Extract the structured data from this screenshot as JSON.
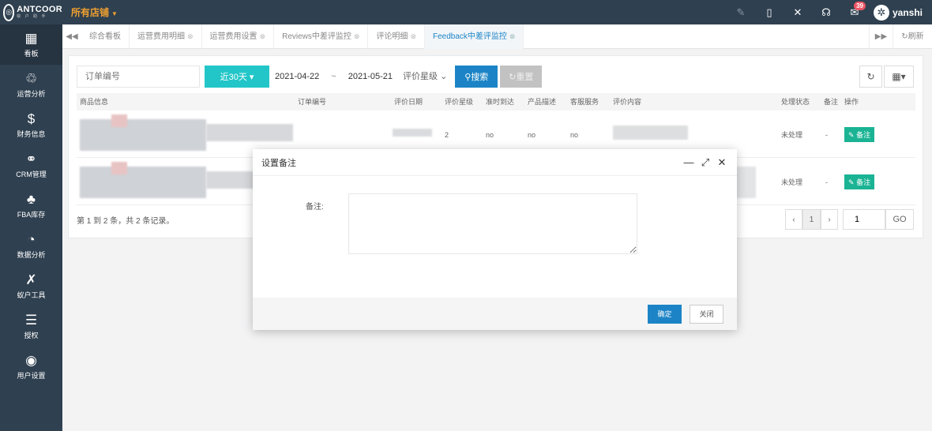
{
  "header": {
    "logo_text": "ANTCOOR",
    "logo_sub": "蚁 户 助 手",
    "shop_label": "所有店铺",
    "notifications_count": "39",
    "username": "yanshi"
  },
  "sidebar": {
    "items": [
      {
        "label": "看板",
        "icon": "dashboard-icon"
      },
      {
        "label": "运营分析",
        "icon": "analysis-icon"
      },
      {
        "label": "财务信息",
        "icon": "finance-icon"
      },
      {
        "label": "CRM管理",
        "icon": "crm-icon"
      },
      {
        "label": "FBA库存",
        "icon": "inventory-icon"
      },
      {
        "label": "数据分析",
        "icon": "pie-chart-icon"
      },
      {
        "label": "蚁户工具",
        "icon": "tools-icon"
      },
      {
        "label": "授权",
        "icon": "sliders-icon"
      },
      {
        "label": "用户设置",
        "icon": "user-icon"
      }
    ]
  },
  "tabs": {
    "items": [
      "综合看板",
      "运营费用明细",
      "运营费用设置",
      "Reviews中差评监控",
      "评论明细",
      "Feedback中差评监控"
    ],
    "refresh_label": "刷新"
  },
  "toolbar": {
    "order_placeholder": "订单编号",
    "range_label": "近30天",
    "date_start": "2021-04-22",
    "date_sep": "~",
    "date_end": "2021-05-21",
    "star_select": "评价星级",
    "search_label": "搜索",
    "reset_label": "重置"
  },
  "table": {
    "headers": [
      "商品信息",
      "订单编号",
      "评价日期",
      "评价星级",
      "准时到达",
      "产品描述",
      "客服服务",
      "评价内容",
      "处理状态",
      "备注",
      "操作"
    ],
    "rows": [
      {
        "star": "2",
        "ontime": "no",
        "desc": "no",
        "service": "no",
        "status": "未处理",
        "remark": "-",
        "action": "备注"
      },
      {
        "star": "",
        "ontime": "",
        "desc": "",
        "service": "",
        "status": "未处理",
        "remark": "-",
        "action": "备注"
      }
    ],
    "summary": "第 1 到 2 条，共 2 条记录。",
    "pager": {
      "prev": "‹",
      "page": "1",
      "next": "›",
      "jump_value": "1",
      "go": "GO"
    }
  },
  "modal": {
    "title": "设置备注",
    "field_label": "备注:",
    "textarea_value": "",
    "ok_label": "确定",
    "close_label": "关闭"
  },
  "colors": {
    "sidebar_bg": "#2f4050",
    "accent_blue": "#1c84c6",
    "accent_teal": "#23c6c8",
    "accent_green": "#1ab394",
    "shop_orange": "#f0a030"
  }
}
